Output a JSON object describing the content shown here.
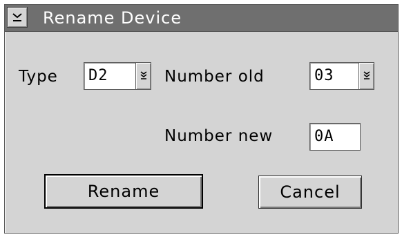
{
  "window": {
    "title": "Rename Device",
    "system_menu_icon": "chevron-down-bar-icon"
  },
  "form": {
    "type_label": "Type",
    "type_value": "D2",
    "number_old_label": "Number old",
    "number_old_value": "03",
    "number_new_label": "Number new",
    "number_new_value": "0A"
  },
  "buttons": {
    "rename_label": "Rename",
    "cancel_label": "Cancel"
  },
  "colors": {
    "titlebar": "#6f6f6f",
    "dialog_background": "#d4d4d4",
    "title_text": "#ffffff"
  }
}
